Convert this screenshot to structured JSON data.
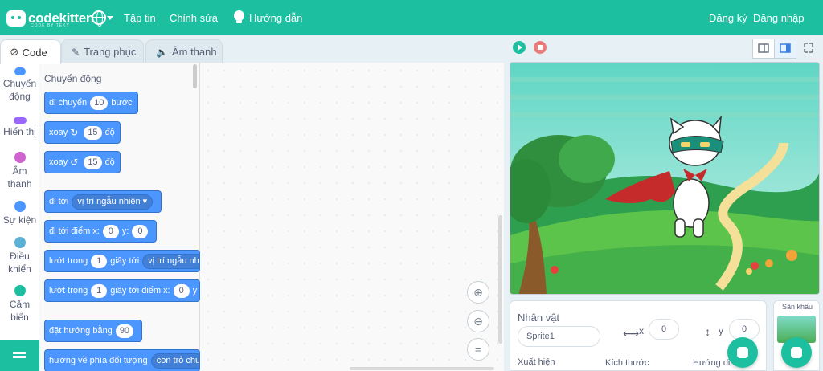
{
  "topbar": {
    "brand": "codekitten",
    "brand_sub": "CODE BY TEKY",
    "menu_file": "Tập tin",
    "menu_edit": "Chỉnh sửa",
    "menu_guide": "Hướng dẫn",
    "signup": "Đăng ký",
    "login": "Đăng nhập"
  },
  "tabs": [
    {
      "label": "Code",
      "icon": "code-icon"
    },
    {
      "label": "Trang phục",
      "icon": "brush-icon"
    },
    {
      "label": "Âm thanh",
      "icon": "speaker-icon"
    }
  ],
  "categories": [
    {
      "label": "Chuyển động",
      "color": "#4c97ff"
    },
    {
      "label": "Hiển thị",
      "color": "#9966ff"
    },
    {
      "label": "Âm thanh",
      "color": "#cf63cf"
    },
    {
      "label": "Sự kiện",
      "color": "#4c97ff"
    },
    {
      "label": "Điều khiển",
      "color": "#5cb1d6"
    },
    {
      "label": "Cảm biến",
      "color": "#1cc0a0"
    }
  ],
  "palette": {
    "section": "Chuyển động",
    "blocks": {
      "move": {
        "a": "di chuyển",
        "v": "10",
        "b": "bước"
      },
      "turn_right": {
        "a": "xoay",
        "v": "15",
        "b": "độ"
      },
      "turn_left": {
        "a": "xoay",
        "v": "15",
        "b": "độ"
      },
      "goto": {
        "a": "đi tới",
        "d": "vị trí ngẫu nhiên"
      },
      "goto_xy": {
        "a": "đi tới điểm x:",
        "x": "0",
        "b": "y:",
        "y": "0"
      },
      "glide": {
        "a": "lướt trong",
        "v": "1",
        "b": "giây tới",
        "d": "vị trí ngẫu nh"
      },
      "glide_xy": {
        "a": "lướt trong",
        "v": "1",
        "b": "giây tới điểm x:",
        "x": "0",
        "c": "y"
      },
      "point": {
        "a": "đặt hướng bằng",
        "v": "90"
      },
      "point_towards": {
        "a": "hướng về phía đối tượng",
        "d": "con trỏ chuộ"
      }
    }
  },
  "sprite": {
    "title": "Nhân vật",
    "name": "Sprite1",
    "x_label": "x",
    "x": "0",
    "y_label": "y",
    "y": "0",
    "show_label": "Xuất hiện",
    "size_label": "Kích thước",
    "direction_label": "Hướng di ch"
  },
  "stage_panel": {
    "title": "Sân khấu"
  }
}
